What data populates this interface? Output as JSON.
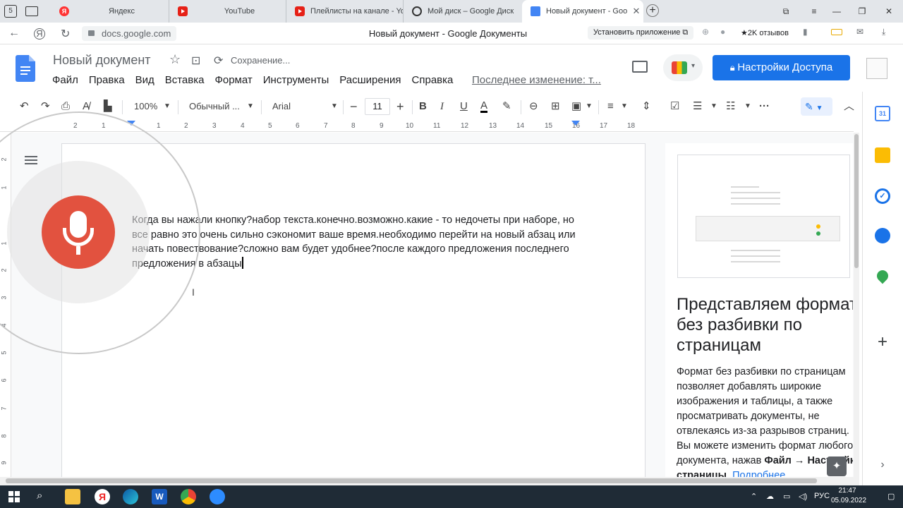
{
  "browser": {
    "tabs": [
      {
        "label": "",
        "icon": "yandex-logo"
      },
      {
        "label": "Яндекс",
        "icon": "yandex-icon"
      },
      {
        "label": "YouTube",
        "icon": "youtube-icon"
      },
      {
        "label": "Плейлисты на канале - Yo",
        "icon": "youtube-icon"
      },
      {
        "label": "Мой диск – Google Диск",
        "icon": "google-drive-icon"
      },
      {
        "label": "Новый документ - Goo",
        "icon": "google-docs-icon"
      }
    ],
    "url": "docs.google.com",
    "page_title": "Новый документ - Google Документы",
    "install_label": "Установить приложение",
    "reviews_label": "★2K отзывов",
    "ya_glyph": "Я"
  },
  "docs": {
    "doc_title": "Новый документ",
    "saving": "Сохранение...",
    "menu": [
      "Файл",
      "Правка",
      "Вид",
      "Вставка",
      "Формат",
      "Инструменты",
      "Расширения",
      "Справка"
    ],
    "last_edit": "Последнее изменение: т...",
    "share_label": "Настройки Доступа",
    "zoom": "100%",
    "style": "Обычный ...",
    "font": "Arial",
    "font_size": "11",
    "ruler_numbers": [
      "2",
      "1",
      "1",
      "2",
      "3",
      "4",
      "5",
      "6",
      "7",
      "8",
      "9",
      "10",
      "11",
      "12",
      "13",
      "14",
      "15",
      "16",
      "17",
      "18"
    ],
    "vruler_numbers": [
      "2",
      "1",
      "1",
      "2",
      "3",
      "4",
      "5",
      "6",
      "7",
      "8",
      "9"
    ],
    "body_text": "Когда вы нажали кнопку?набор текста.конечно.возможно.какие - то недочеты при наборе, но все равно это очень сильно сэкономит ваше время.необходимо перейти на новый абзац или начать повествование?сложно вам будет удобнее?после каждого предложения последнего предложения в абзацы"
  },
  "panel": {
    "heading": "Представляем формат без разбивки по страницам",
    "para_1": "Формат без разбивки по страницам позволяет добавлять широкие изображения и таблицы, а также просматривать документы, не отвлекаясь из-за разрывов страниц. Вы можете изменить формат любого документа, нажав ",
    "para_bold": "Файл → Настройки страницы",
    "para_2": ". ",
    "link": "Подробнее..."
  },
  "taskbar": {
    "lang": "РУС",
    "time": "21:47",
    "date": "05.09.2022"
  },
  "colors": {
    "share_button": "#1a73e8",
    "mic_button": "#e2523f",
    "taskbar": "#1f2b36"
  }
}
